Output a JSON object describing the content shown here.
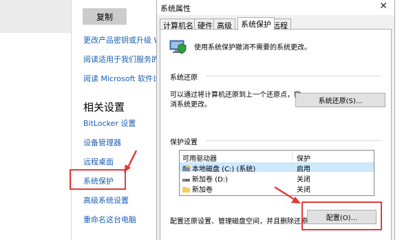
{
  "settings": {
    "copy_label": "复制",
    "links": [
      "更改产品密钥或升级 W",
      "阅读适用于我们服务的",
      "阅读 Microsoft 软件许可"
    ],
    "related_heading": "相关设置",
    "related_links": [
      "BitLocker 设置",
      "设备管理器",
      "远程桌面",
      "系统保护",
      "高级系统设置",
      "重命名这台电脑"
    ]
  },
  "dialog": {
    "title": "系统属性",
    "close_glyph": "✕",
    "tabs": [
      "计算机名",
      "硬件",
      "高级",
      "系统保护",
      "远程"
    ],
    "active_tab": "系统保护",
    "intro": "使用系统保护撤消不需要的系统更改。",
    "restore_group": {
      "title": "系统还原",
      "desc": "可以通过将计算机还原到上一个还原点，撤消系统更改。",
      "button": "系统还原(S)..."
    },
    "protection_group": {
      "title": "保护设置",
      "columns": [
        "可用驱动器",
        "保护"
      ],
      "drives": [
        {
          "name": "本地磁盘 (C:) (系统)",
          "protection": "启用",
          "icon": "system-drive-icon"
        },
        {
          "name": "新加卷 (D:)",
          "protection": "关闭",
          "icon": "drive-icon"
        },
        {
          "name": "新加卷",
          "protection": "关闭",
          "icon": "folder-icon"
        }
      ],
      "config_text": "配置还原设置、管理磁盘空间，并且删除还原点。",
      "config_button": "配置(O)..."
    }
  },
  "colors": {
    "highlight": "#e53935",
    "link": "#1a5fb4",
    "selection": "#cce8ff"
  }
}
